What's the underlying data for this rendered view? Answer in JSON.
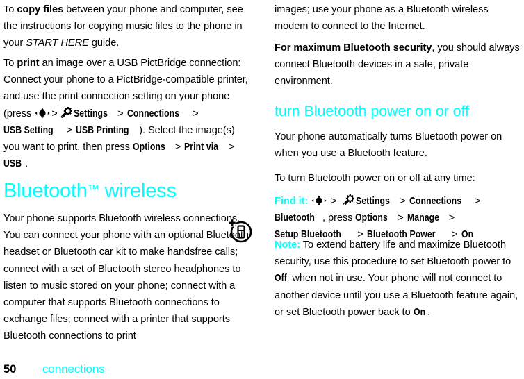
{
  "page": {
    "folio": "50",
    "folio_label": "connections",
    "accent_color": "#00ffff",
    "text_color": "#000000",
    "background": "#ffffff"
  },
  "left_column": {
    "copy_files_paragraph": {
      "part1": "To ",
      "bold1": "copy files",
      "part2": " between your phone and computer, see the instructions for copying music files to the phone in your ",
      "italic1": "START HERE",
      "part3": " guide."
    },
    "print_paragraph": {
      "part1": "To ",
      "bold1": "print",
      "part2": " an image over a USB PictBridge connection: Connect your phone to a PictBridge-compatible printer, and use the print connection setting on your phone (press ",
      "icon1": "center-key-icon",
      "sep1": ">",
      "icon2": "settings-gear-icon",
      "ui1": "Settings",
      "sep2": ">",
      "ui2": "Connections",
      "sep3": ">",
      "ui3": "USB Setting",
      "sep4": ">",
      "ui4": "USB Printing",
      "part3": "). Select the image(s) you want to print, then press ",
      "ui5": "Options",
      "sep5": ">",
      "ui6": "Print via",
      "sep6": ">",
      "ui7": "USB",
      "part4": "."
    },
    "heading": {
      "text": "Bluetooth",
      "trademark": "™",
      "text2": " wireless"
    },
    "supports_paragraph": "Your phone supports Bluetooth wireless connections. You can connect your phone with an optional Bluetooth headset or Bluetooth car kit to make handsfree calls; connect with a set of Bluetooth stereo headphones to listen to music stored on your phone; connect with a computer that supports Bluetooth connections to exchange files; connect with a printer that supports Bluetooth connections to print",
    "float_icon": "bluetooth-connect-device-icon"
  },
  "right_column": {
    "images_paragraph": "images; use your phone as a Bluetooth wireless modem to connect to the Internet.",
    "security_paragraph": {
      "bold1": "For maximum Bluetooth security",
      "part1": ", you should always connect Bluetooth devices in a safe, private environment."
    },
    "heading": "turn Bluetooth power on or off",
    "auto_paragraph": "Your phone automatically turns Bluetooth power on when you use a Bluetooth feature.",
    "toturn_paragraph": "To turn Bluetooth power on or off at any time:",
    "find_it": {
      "label": "Find it:",
      "icon1": "center-key-icon",
      "sep1": ">",
      "icon2": "settings-gear-icon",
      "ui1": "Settings",
      "sep2": ">",
      "ui2": "Connections",
      "sep3": ">",
      "ui3": "Bluetooth",
      "after": ", press ",
      "ui4": "Options",
      "sep4": ">",
      "ui5": "Manage",
      "sep5": ">",
      "ui6": "Setup Bluetooth",
      "sep6": ">",
      "ui7": "Bluetooth Power",
      "sep7": ">",
      "ui8": "On"
    },
    "note": {
      "label": "Note:",
      "part1": " To extend battery life and maximize Bluetooth security, use this procedure to set Bluetooth power to ",
      "ui1": "Off",
      "part2": " when not in use. Your phone will not connect to another device until you use a Bluetooth feature again, or set Bluetooth power back to ",
      "ui2": "On",
      "part3": "."
    }
  }
}
